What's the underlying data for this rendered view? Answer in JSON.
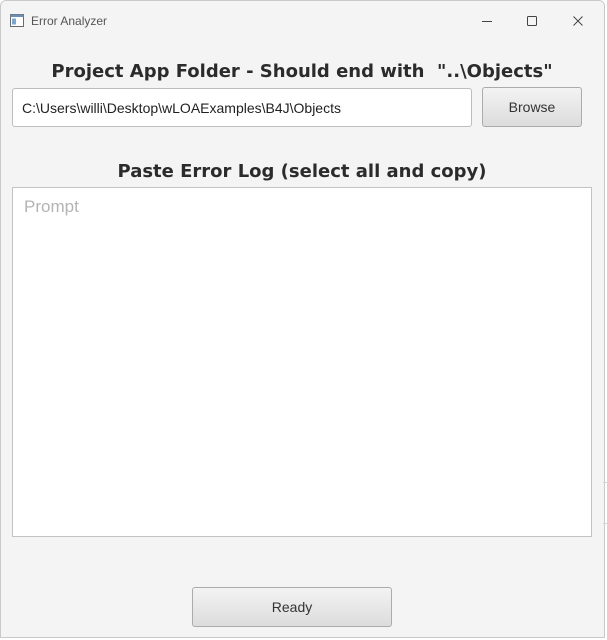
{
  "window": {
    "title": "Error Analyzer",
    "icons": [
      "app-icon",
      "minimize-icon",
      "maximize-icon",
      "close-icon"
    ]
  },
  "project_folder": {
    "heading": "Project App Folder - Should end with  \"..\\Objects\"",
    "path_value": "C:\\Users\\willi\\Desktop\\wLOAExamples\\B4J\\Objects",
    "browse_label": "Browse"
  },
  "error_log": {
    "heading": "Paste Error Log (select all and copy)",
    "placeholder": "Prompt",
    "value": ""
  },
  "status": {
    "button_label": "Ready"
  },
  "colors": {
    "window_bg": "#f4f4f4",
    "heading_text": "#2b2b2b",
    "placeholder_text": "#b4b4b4"
  }
}
